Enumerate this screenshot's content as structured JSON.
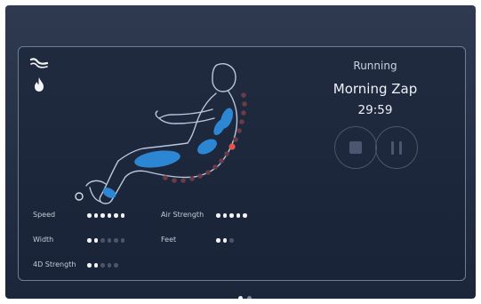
{
  "status": {
    "label": "Running",
    "program": "Morning Zap",
    "timer": "29:59"
  },
  "controls": {
    "stop_icon": "stop-icon",
    "pause_icon": "pause-icon"
  },
  "side_icons": [
    "zero-gravity-recline-icon",
    "heat-flame-icon"
  ],
  "settings": [
    {
      "label": "Speed",
      "level": 6,
      "max": 6
    },
    {
      "label": "Width",
      "level": 2,
      "max": 6
    },
    {
      "label": "4D Strength",
      "level": 2,
      "max": 5
    },
    {
      "label": "Air Strength",
      "level": 5,
      "max": 5
    },
    {
      "label": "Feet",
      "level": 2,
      "max": 3
    }
  ],
  "pagination": {
    "count": 2,
    "active": 0
  },
  "colors": {
    "airbag": "#2f8fe0",
    "roller_indicator": "#e0574a",
    "track_dots": "#6b3c46",
    "figure_outline": "#b8c6de"
  }
}
